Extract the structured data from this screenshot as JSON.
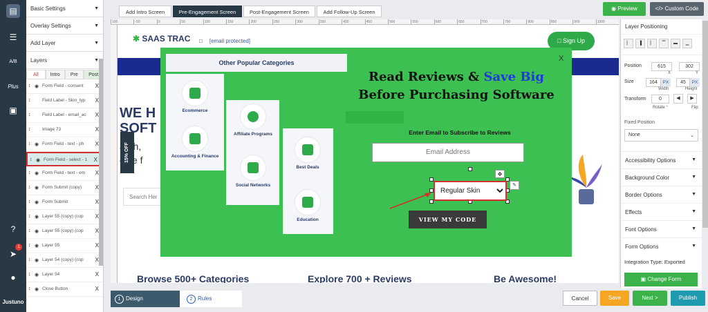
{
  "rail": {
    "icons": [
      "design-icon",
      "library-icon",
      "ab-test-icon",
      "plus-icon",
      "analytics-icon",
      "help-icon",
      "announcements-icon",
      "account-icon"
    ],
    "ab_label": "A/B",
    "plus_label": "Plus",
    "notification_count": "1",
    "brand": "Justuno"
  },
  "left_panel": {
    "basic_settings": "Basic Settings",
    "overlay_settings": "Overlay Settings",
    "add_layer": "Add Layer",
    "layers": "Layers",
    "tabs": [
      "All",
      "Intro",
      "Pre",
      "Post"
    ],
    "layer_rows": [
      {
        "name": "Form Field - consent",
        "type": "field"
      },
      {
        "name": "Field Label - Skin_typ",
        "type": "label"
      },
      {
        "name": "Field Label - email_ac",
        "type": "label"
      },
      {
        "name": "Image 73",
        "type": "image"
      },
      {
        "name": "Form Field - text - ph",
        "type": "field"
      },
      {
        "name": "Form Field - select - 1",
        "type": "field",
        "selected": true
      },
      {
        "name": "Form Field - text - em",
        "type": "field"
      },
      {
        "name": "Form Submit (copy)",
        "type": "field"
      },
      {
        "name": "Form Submit",
        "type": "field"
      },
      {
        "name": "Layer 55 (copy) (cop",
        "type": "field"
      },
      {
        "name": "Layer 55 (copy) (cop",
        "type": "field"
      },
      {
        "name": "Layer 55",
        "type": "field"
      },
      {
        "name": "Layer 54 (copy) (cop",
        "type": "field"
      },
      {
        "name": "Layer 54",
        "type": "field"
      },
      {
        "name": "Close Button",
        "type": "field"
      }
    ],
    "remove_label": "X"
  },
  "topbar": {
    "screen_tabs": [
      "Add Intro Screen",
      "Pre-Engagement Screen",
      "Post-Engagement Screen",
      "Add Follow-Up Screen"
    ],
    "active_tab": 1,
    "preview": "Preview",
    "custom_code": "Custom Code"
  },
  "ruler": {
    "ticks": [
      "100",
      "-50",
      "0",
      "50",
      "100",
      "150",
      "200",
      "250",
      "300",
      "350",
      "400",
      "450",
      "500",
      "550",
      "600",
      "650",
      "700",
      "750",
      "800",
      "850",
      "900",
      "1000"
    ]
  },
  "site": {
    "logo": "SAAS TRAC",
    "email": "[email protected]",
    "signup": "Sign Up",
    "hero_line1": "WE H",
    "hero_line2": "SOFT",
    "hero_sub1": "arch,",
    "hero_sub2": "oice f",
    "search_placeholder": "Search Her",
    "off_tag": "15% OFF",
    "bottom_texts": [
      "Browse 500+ Categories",
      "Explore 700 + Reviews",
      "Be Awesome!"
    ]
  },
  "popup": {
    "categories_title": "Other Popular Categories",
    "categories": [
      "Ecommerce",
      "Accounting & Finance",
      "Affiliate Programs",
      "Social Networks",
      "Best Deals",
      "Education"
    ],
    "close": "X",
    "headline_part1": "Read Reviews  & ",
    "headline_highlight": "Save Big",
    "headline_line2": "Before Purchasing Software",
    "subscribe_label": "Enter Email to Subscribe to Reviews",
    "email_placeholder": "Email Address",
    "select_value": "Regular Skin",
    "cta": "VIEW MY CODE",
    "colors": {
      "background": "#3cc051",
      "highlight": "#1e3bd8",
      "cta": "#3a3a3a"
    }
  },
  "right_panel": {
    "title": "Layer Positioning",
    "position_label": "Position",
    "position_x": "615",
    "position_y": "302",
    "x_label": "X",
    "y_label": "Y",
    "size_label": "Size",
    "width": "164",
    "height": "45",
    "unit": "PX",
    "width_label": "Width",
    "height_label": "Height",
    "transform_label": "Transform",
    "rotate": "0",
    "rotate_label": "Rotate °",
    "flip_label": "Flip",
    "fixed_position_label": "Fixed Position",
    "fixed_position_value": "None",
    "options": [
      "Accessibility Options",
      "Background Color",
      "Border Options",
      "Effects",
      "Font Options",
      "Form Options"
    ],
    "integration": "Integration Type: Exported",
    "change_form": "Change Form"
  },
  "bottombar": {
    "step1_num": "1",
    "step1": "Design",
    "step2_num": "2",
    "step2": "Rules",
    "cancel": "Cancel",
    "save": "Save",
    "next": "Next >",
    "publish": "Publish"
  }
}
